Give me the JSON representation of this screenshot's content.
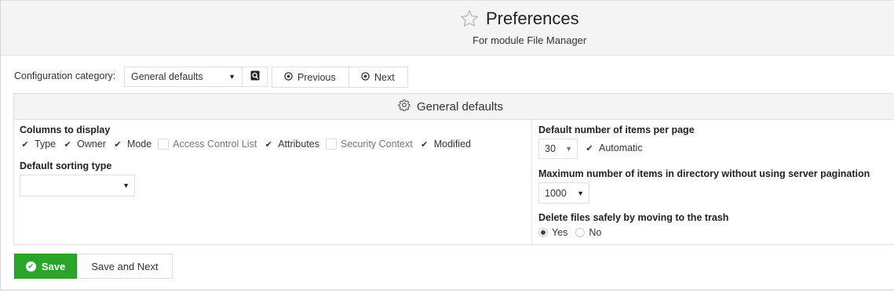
{
  "header": {
    "title": "Preferences",
    "subtitle": "For module File Manager"
  },
  "config": {
    "label": "Configuration category:",
    "selected": "General defaults",
    "previous_label": "Previous",
    "next_label": "Next"
  },
  "panel": {
    "title": "General defaults",
    "columns_label": "Columns to display",
    "columns": [
      {
        "label": "Type",
        "checked": true
      },
      {
        "label": "Owner",
        "checked": true
      },
      {
        "label": "Mode",
        "checked": true
      },
      {
        "label": "Access Control List",
        "checked": false
      },
      {
        "label": "Attributes",
        "checked": true
      },
      {
        "label": "Security Context",
        "checked": false
      },
      {
        "label": "Modified",
        "checked": true
      }
    ],
    "sorting_label": "Default sorting type",
    "sorting_value": "",
    "items_per_page_label": "Default number of items per page",
    "items_per_page_value": "30",
    "automatic_label": "Automatic",
    "max_items_label": "Maximum number of items in directory without using server pagination",
    "max_items_value": "1000",
    "delete_label": "Delete files safely by moving to the trash",
    "delete_yes": "Yes",
    "delete_no": "No"
  },
  "actions": {
    "save_label": "Save",
    "save_next_label": "Save and Next"
  }
}
